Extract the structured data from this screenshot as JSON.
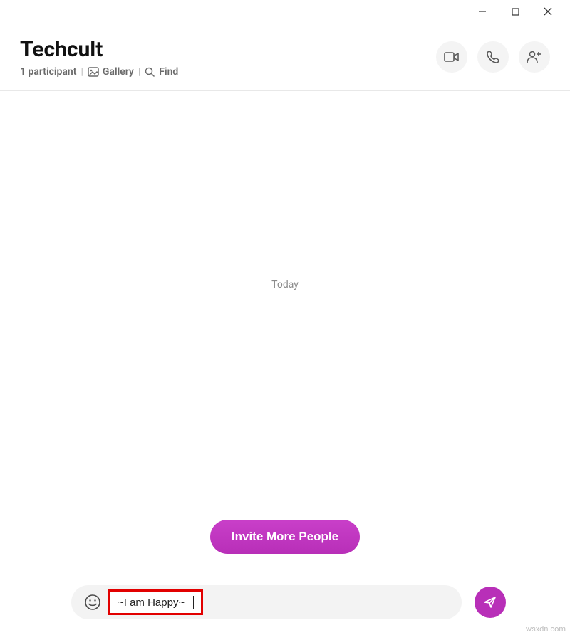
{
  "window": {
    "minimize": "Minimize",
    "maximize": "Maximize",
    "close": "Close"
  },
  "header": {
    "title": "Techcult",
    "participants": "1 participant",
    "gallery": "Gallery",
    "find": "Find"
  },
  "actions": {
    "video": "Video Call",
    "audio": "Audio Call",
    "add": "Add Participants"
  },
  "chat": {
    "date_divider": "Today",
    "invite_button": "Invite More People"
  },
  "composer": {
    "emoji": "Emoji",
    "message_value": "~I am Happy~",
    "send": "Send"
  },
  "watermark": "wsxdn.com"
}
